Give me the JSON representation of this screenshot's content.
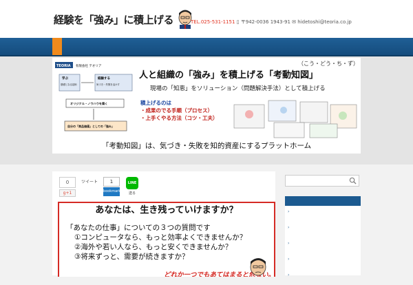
{
  "header": {
    "tagline": "",
    "logo_text": "経験を「強み」に積上げる",
    "tel": "TEL.025-531-1151",
    "contact_rest": "〒942-0036 ",
    "contact_mid": "1943-91 ",
    "email": "hidetoshi@teoria.co.jp"
  },
  "nav": {
    "items": [
      "",
      "",
      "",
      "",
      "",
      "",
      "",
      ""
    ]
  },
  "banner": {
    "company": "有限会社 テオリア",
    "kana": "（こう・どう・ち・ず）",
    "title": "人と組織の「強み」を積上げる「考動知図」",
    "subtitle": "現場の「知恵」をソリューション（問題解決手法）として積上げる",
    "points_head": "積上げるのは",
    "point_1": "・成果のでる手順（プロセス）",
    "point_2": "・上手くやる方法（コツ・工夫）",
    "diagram_step_1": "学ぶ",
    "diagram_step_1_sub": "基礎となる技術",
    "diagram_step_2": "経験する",
    "diagram_step_2_sub": "気づき・失敗を活かす",
    "diagram_step_3": "オリジナル・ノウハウを築く",
    "diagram_step_4": "自分の「商品価値」としての「強み」",
    "footer": "「考動知図」は、気づき・失敗を知的資産にするプラットホーム"
  },
  "share": {
    "fb_count": "0",
    "gplus": "g+1",
    "tweet": "ツイート",
    "hatena_count": "1",
    "hatena_label": "bookmark",
    "line_label": "LINE",
    "line_sub": "送る"
  },
  "article": {
    "headline": "あなたは、生き残っていけますか？",
    "lead": "「あなたの仕事」についての３つの質問です",
    "q1": "①コンピュータなら、もっと効率よくできませんか？",
    "q2": "②海外や若い人なら、もっと安くできませんか？",
    "q3": "③将来ずっと、需要が続きますか？",
    "punch": "どれか一つでもあてはまると危ない。"
  },
  "sidebar": {
    "widget_title": "",
    "items": [
      "",
      "",
      "",
      "",
      ""
    ]
  },
  "colors": {
    "nav_bg": "#1f5f96",
    "nav_active": "#f08a1c",
    "accent_red": "#d52a24",
    "tel_red": "#e0301e",
    "link_blue": "#1c5a90"
  }
}
